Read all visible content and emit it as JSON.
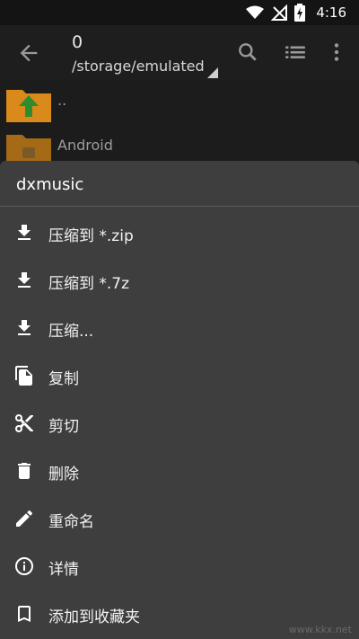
{
  "status_bar": {
    "time": "4:16",
    "icons": [
      "wifi-icon",
      "no-signal-icon",
      "battery-charging-icon"
    ]
  },
  "app_bar": {
    "title": "0",
    "path": "/storage/emulated",
    "icons": [
      "back-arrow-icon",
      "search-icon",
      "list-view-icon",
      "more-vert-icon"
    ]
  },
  "files": [
    {
      "name": "..",
      "icon": "folder-up-icon"
    },
    {
      "name": "Android",
      "icon": "android-folder-icon"
    }
  ],
  "sheet": {
    "title": "dxmusic",
    "items": [
      {
        "label": "压缩到 *.zip",
        "icon": "download-icon"
      },
      {
        "label": "压缩到 *.7z",
        "icon": "download-icon"
      },
      {
        "label": "压缩...",
        "icon": "download-icon"
      },
      {
        "label": "复制",
        "icon": "copy-icon"
      },
      {
        "label": "剪切",
        "icon": "scissors-icon"
      },
      {
        "label": "删除",
        "icon": "trash-icon"
      },
      {
        "label": "重命名",
        "icon": "pencil-icon"
      },
      {
        "label": "详情",
        "icon": "info-icon"
      },
      {
        "label": "添加到收藏夹",
        "icon": "bookmark-icon"
      }
    ]
  },
  "watermark": "www.kkx.net",
  "colors": {
    "folder": "#d98a1a",
    "up_arrow": "#2e8b2e",
    "sheet_bg": "#3e3e3e",
    "app_bg": "#1e1e1e"
  }
}
